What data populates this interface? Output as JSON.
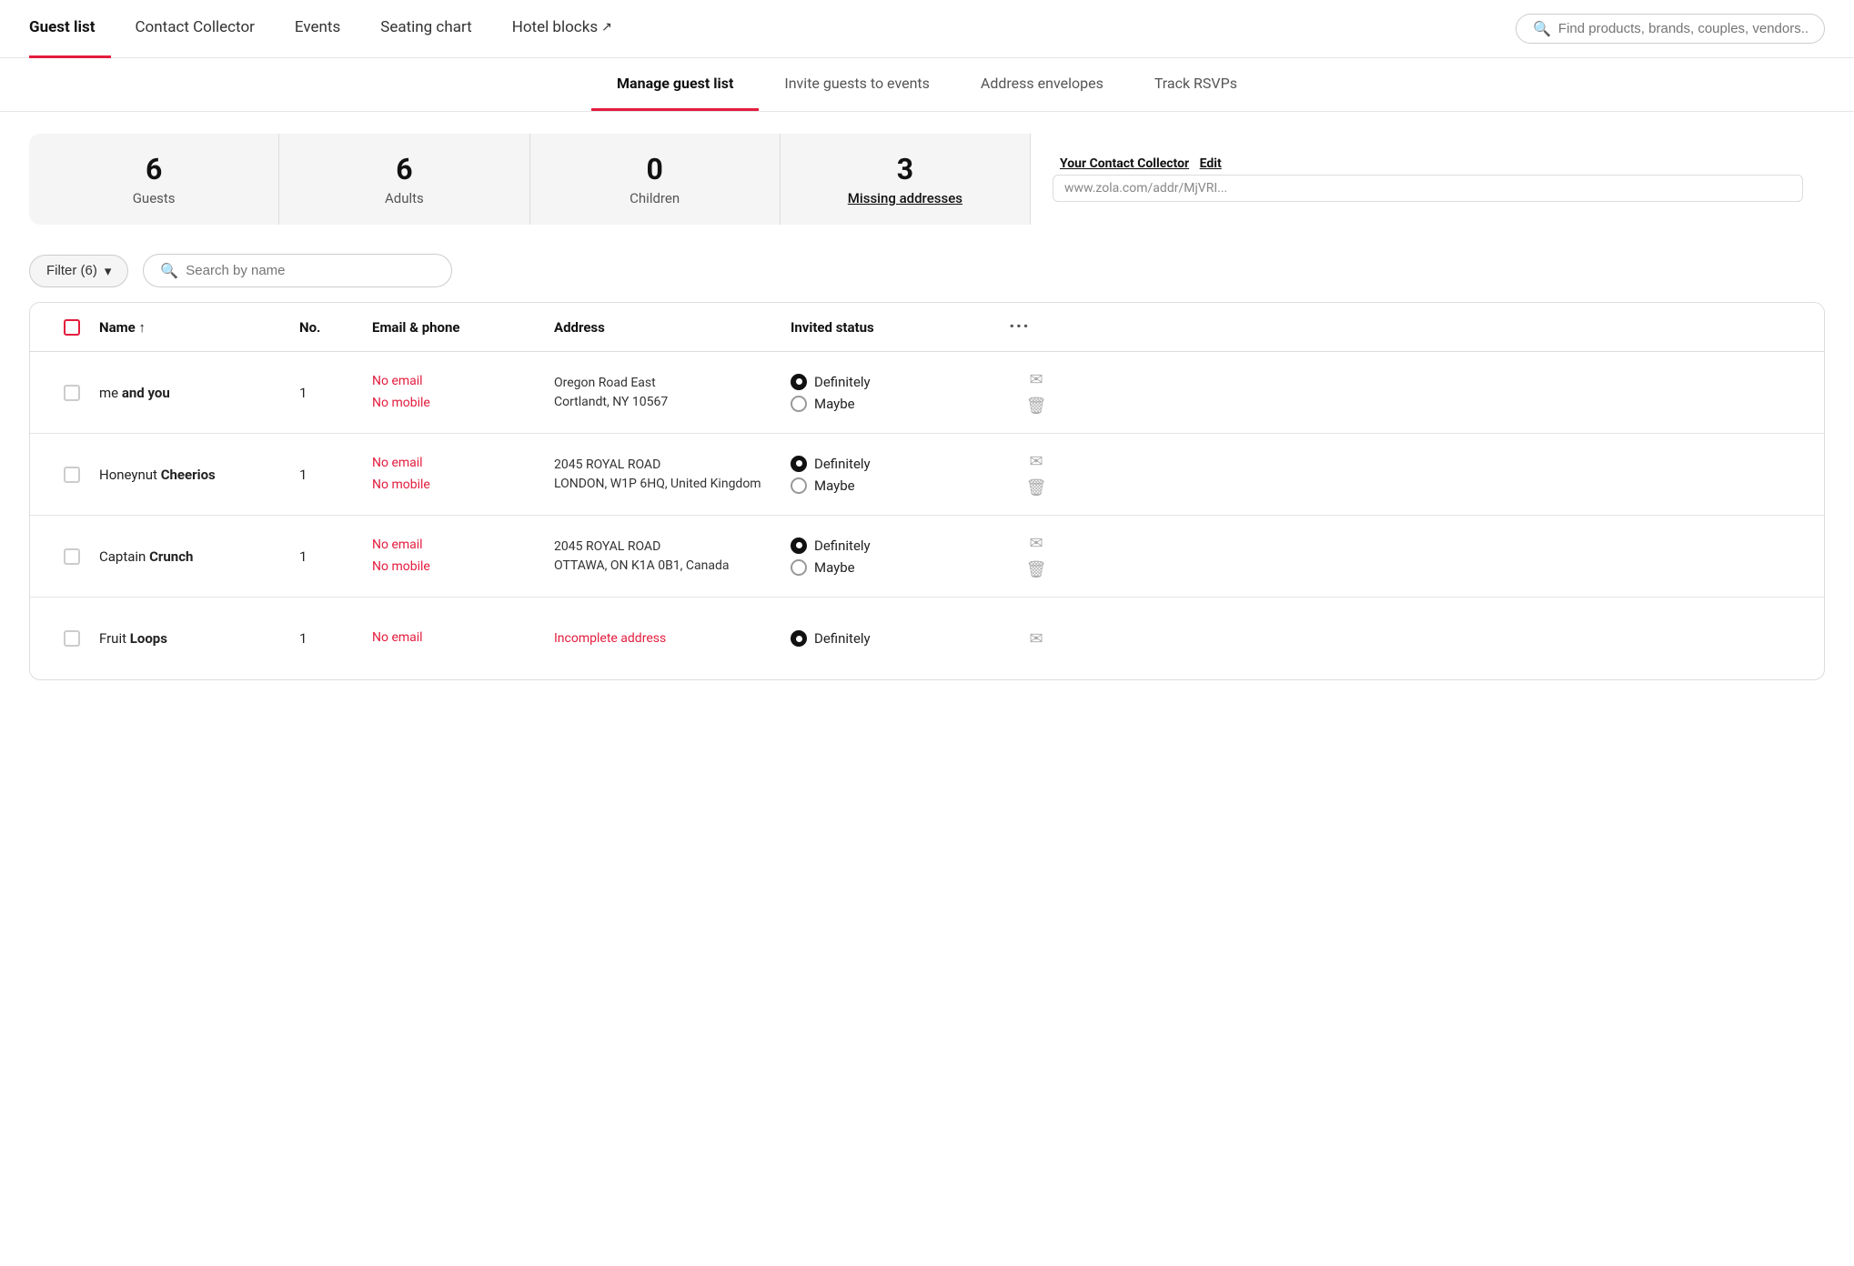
{
  "nav": {
    "items": [
      {
        "id": "guest-list",
        "label": "Guest list",
        "active": true
      },
      {
        "id": "contact-collector",
        "label": "Contact Collector",
        "active": false
      },
      {
        "id": "events",
        "label": "Events",
        "active": false
      },
      {
        "id": "seating-chart",
        "label": "Seating chart",
        "active": false
      },
      {
        "id": "hotel-blocks",
        "label": "Hotel blocks",
        "active": false,
        "external": true
      }
    ],
    "search_placeholder": "Find products, brands, couples, vendors..."
  },
  "sub_nav": {
    "items": [
      {
        "id": "manage",
        "label": "Manage guest list",
        "active": true
      },
      {
        "id": "invite",
        "label": "Invite guests to events",
        "active": false
      },
      {
        "id": "address",
        "label": "Address envelopes",
        "active": false
      },
      {
        "id": "track",
        "label": "Track RSVPs",
        "active": false
      }
    ]
  },
  "stats": {
    "guests": {
      "number": "6",
      "label": "Guests"
    },
    "adults": {
      "number": "6",
      "label": "Adults"
    },
    "children": {
      "number": "0",
      "label": "Children"
    },
    "missing": {
      "number": "3",
      "label": "Missing addresses"
    }
  },
  "contact_collector": {
    "title": "Your Contact Collector",
    "edit_label": "Edit",
    "url": "www.zola.com/addr/MjVRI..."
  },
  "filter": {
    "btn_label": "Filter (6)",
    "search_placeholder": "Search by name"
  },
  "table": {
    "headers": {
      "name": "Name ↑",
      "no": "No.",
      "email_phone": "Email & phone",
      "address": "Address",
      "invited_status": "Invited status"
    },
    "rows": [
      {
        "first": "me",
        "last": "and you",
        "number": "1",
        "email": "No email",
        "phone": "No mobile",
        "address_line1": "Oregon Road East",
        "address_line2": "Cortlandt, NY 10567",
        "address_incomplete": false,
        "status_definitely": true,
        "status_maybe": false
      },
      {
        "first": "Honeynut",
        "last": "Cheerios",
        "number": "1",
        "email": "No email",
        "phone": "No mobile",
        "address_line1": "2045 ROYAL ROAD",
        "address_line2": "LONDON, W1P 6HQ, United Kingdom",
        "address_incomplete": false,
        "status_definitely": true,
        "status_maybe": false
      },
      {
        "first": "Captain",
        "last": "Crunch",
        "number": "1",
        "email": "No email",
        "phone": "No mobile",
        "address_line1": "2045 ROYAL ROAD",
        "address_line2": "OTTAWA, ON K1A 0B1, Canada",
        "address_incomplete": false,
        "status_definitely": true,
        "status_maybe": false
      },
      {
        "first": "Fruit",
        "last": "Loops",
        "number": "1",
        "email": "No email",
        "phone": "",
        "address_line1": "Incomplete address",
        "address_line2": "",
        "address_incomplete": true,
        "status_definitely": true,
        "status_maybe": false
      }
    ],
    "definitely_label": "Definitely",
    "maybe_label": "Maybe"
  }
}
